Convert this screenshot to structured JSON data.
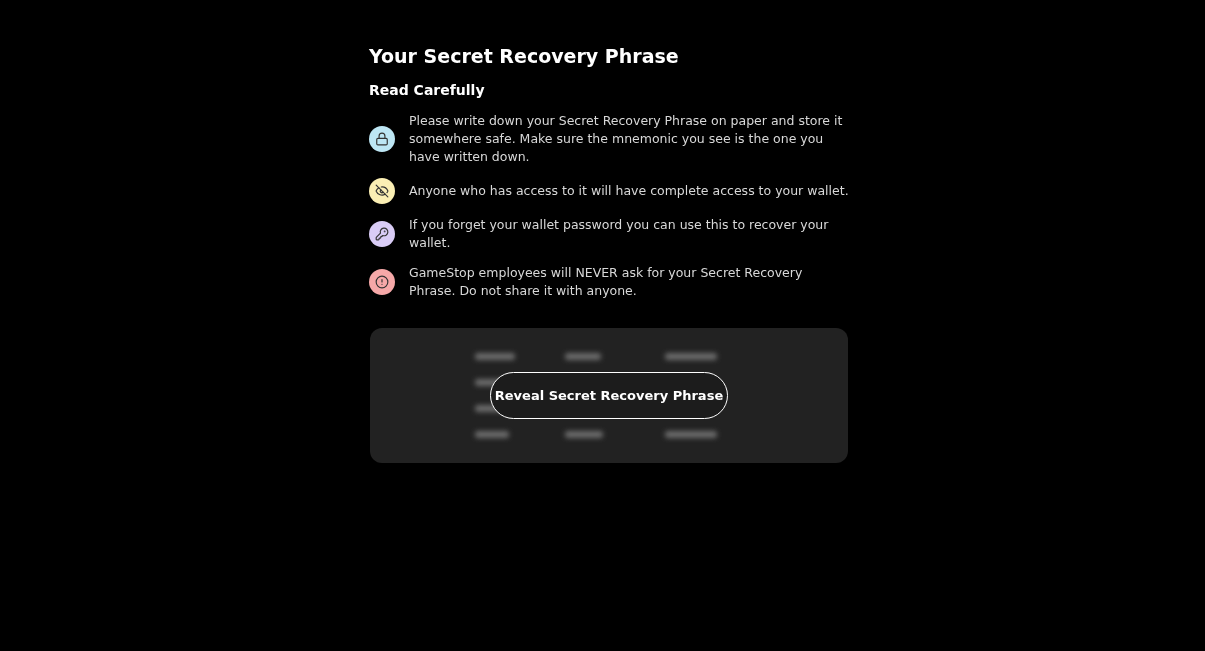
{
  "title": "Your Secret Recovery Phrase",
  "subtitle": "Read Carefully",
  "notes": [
    {
      "kind": "lock",
      "color": "#bde6f4",
      "text": "Please write down your Secret Recovery Phrase on paper and store it somewhere safe. Make sure the mnemonic you see is the one you have written down."
    },
    {
      "kind": "eye-off",
      "color": "#fbefb4",
      "text": "Anyone who has access to it will have complete access to your wallet."
    },
    {
      "kind": "key",
      "color": "#d9ccf6",
      "text": "If you forget your wallet password you can use this to recover your wallet."
    },
    {
      "kind": "alert",
      "color": "#f6a8a8",
      "text": "GameStop employees will NEVER ask for your Secret Recovery Phrase. Do not share it with anyone."
    }
  ],
  "reveal_button": "Reveal Secret Recovery Phrase"
}
